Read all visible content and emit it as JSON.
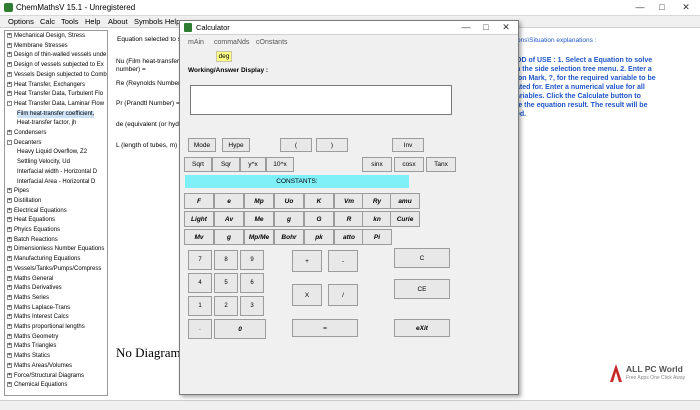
{
  "window": {
    "title": "ChemMathsV 15.1 - Unregistered",
    "controls": [
      "—",
      "□",
      "✕"
    ]
  },
  "menu": [
    "Options",
    "Calc",
    "Tools",
    "Help",
    "About",
    "Symbols Help"
  ],
  "tree": [
    {
      "label": "Mechanical Design, Stress",
      "sign": "+"
    },
    {
      "label": "Membrane Stresses",
      "sign": "+"
    },
    {
      "label": "Design of thin-walled vessels unde",
      "sign": "+"
    },
    {
      "label": "Design of vessels subjected to Ex",
      "sign": "+"
    },
    {
      "label": "Vessels Design subjected to Comb",
      "sign": "+"
    },
    {
      "label": "Heat Transfer, Exchangers",
      "sign": "+"
    },
    {
      "label": "Heat Transfer Data, Turbulent Flo",
      "sign": "+"
    },
    {
      "label": "Heat Transfer Data, Laminar Flow",
      "sign": "-"
    },
    {
      "label": "Film heat-transfer coefficient,",
      "sign": "",
      "indent": 2,
      "selected": true
    },
    {
      "label": "Heat-transfer factor, jh",
      "sign": "",
      "indent": 2
    },
    {
      "label": "Condensers",
      "sign": "+"
    },
    {
      "label": "Decanters",
      "sign": "-"
    },
    {
      "label": "Heavy Liquid Overflow, Z2",
      "sign": "",
      "indent": 2
    },
    {
      "label": "Settling Velocity, Ud",
      "sign": "",
      "indent": 2
    },
    {
      "label": "Interfacial width - Horizontal D",
      "sign": "",
      "indent": 2
    },
    {
      "label": "Interfacial Area - Horizontal D",
      "sign": "",
      "indent": 2
    },
    {
      "label": "Pipes",
      "sign": "+"
    },
    {
      "label": "Distillation",
      "sign": "+"
    },
    {
      "label": "Electrical Equations",
      "sign": "+"
    },
    {
      "label": "Heat Equations",
      "sign": "+"
    },
    {
      "label": "Phyics Equations",
      "sign": "+"
    },
    {
      "label": "Batch Reactions",
      "sign": "+"
    },
    {
      "label": "Dimensionless Number Equations",
      "sign": "+"
    },
    {
      "label": "Manufacturing Equations",
      "sign": "+"
    },
    {
      "label": "Vessels/Tanks/Pumps/Compress",
      "sign": "+"
    },
    {
      "label": "Maths General",
      "sign": "+"
    },
    {
      "label": "Maths Derivatives",
      "sign": "+"
    },
    {
      "label": "Maths Series",
      "sign": "+"
    },
    {
      "label": "Maths Laplace-Trans",
      "sign": "+"
    },
    {
      "label": "Maths Interest Calcs",
      "sign": "+"
    },
    {
      "label": "Maths proportional lengths",
      "sign": "+"
    },
    {
      "label": "Maths Geometry",
      "sign": "+"
    },
    {
      "label": "Maths Triangles",
      "sign": "+"
    },
    {
      "label": "Maths Statics",
      "sign": "+"
    },
    {
      "label": "Maths Areas/Volumes",
      "sign": "+"
    },
    {
      "label": "Force/Structural Diagrams",
      "sign": "+"
    },
    {
      "label": "Chemical Equations",
      "sign": "+"
    }
  ],
  "main": {
    "equation_selected": "Equation selected to s",
    "field_nu": "Nu (Film heat-transfer",
    "field_nu2": "number) =",
    "field_re": "Re (Reynolds Number) =",
    "field_pr": "Pr (Prandtl Number) =",
    "field_de": "de (equivalent (or hydra",
    "field_l": "L (length of tubes, m) =",
    "explanations_link": "ons\\Situation explanations :",
    "help_lines": [
      "OD of USE : 1. Select a Equation to solve",
      "n the side selection tree menu. 2. Enter a",
      "ion Mark, ?, for the required variable to be",
      "ated for. Enter a numerical value for all",
      "ariables. Click the Calculate button to",
      "te the equation result. The result will be",
      "ed."
    ],
    "no_diagram": "No Diagram"
  },
  "calculator": {
    "title": "Calculator",
    "tabs": [
      "mAin",
      "commaNds",
      "cOnstants"
    ],
    "deg": "deg",
    "working_label": "Working/Answer Display :",
    "display_value": "",
    "row1": [
      "Mode",
      "Hype",
      "(",
      ")",
      "Inv"
    ],
    "row2": [
      "Sqrt",
      "Sqr",
      "y^x",
      "10^x",
      "sinx",
      "cosx",
      "Tanx"
    ],
    "constants_label": "CONSTANTS:",
    "const_row1": [
      "F",
      "e",
      "Mp",
      "Uo",
      "K",
      "Vm",
      "Ry",
      "amu"
    ],
    "const_row2": [
      "Light",
      "Av",
      "Me",
      "g",
      "G",
      "R",
      "kn",
      "Curie"
    ],
    "const_row3": [
      "Mv",
      "g",
      "Mp/Me",
      "Bohr",
      "pk",
      "atto",
      "Pi"
    ],
    "digits": [
      "7",
      "8",
      "9",
      "4",
      "5",
      "6",
      "1",
      "2",
      "3",
      ".",
      "0"
    ],
    "ops": [
      "+",
      "-",
      "X",
      "/",
      "="
    ],
    "actions": [
      "C",
      "CE",
      "eXit"
    ]
  },
  "watermark": {
    "brand": "ALL PC World",
    "sub": "Free Apps One Click Away"
  }
}
